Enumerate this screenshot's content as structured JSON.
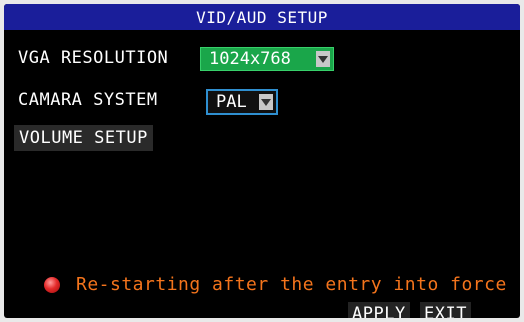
{
  "title": "VID/AUD SETUP",
  "vga_resolution": {
    "label": "VGA RESOLUTION",
    "value": "1024x768"
  },
  "camera_system": {
    "label": "CAMARA SYSTEM",
    "value": "PAL"
  },
  "volume_setup": {
    "label": "VOLUME SETUP"
  },
  "notice": {
    "text": "Re-starting after the entry into force",
    "icon": "warning-dot-icon"
  },
  "buttons": {
    "apply": "APPLY",
    "exit": "EXIT"
  },
  "colors": {
    "title_bar": "#1a1e9a",
    "selected_dropdown": "#1aa64a",
    "dropdown_border": "#2f8fd0",
    "notice_text": "#f4741c"
  }
}
